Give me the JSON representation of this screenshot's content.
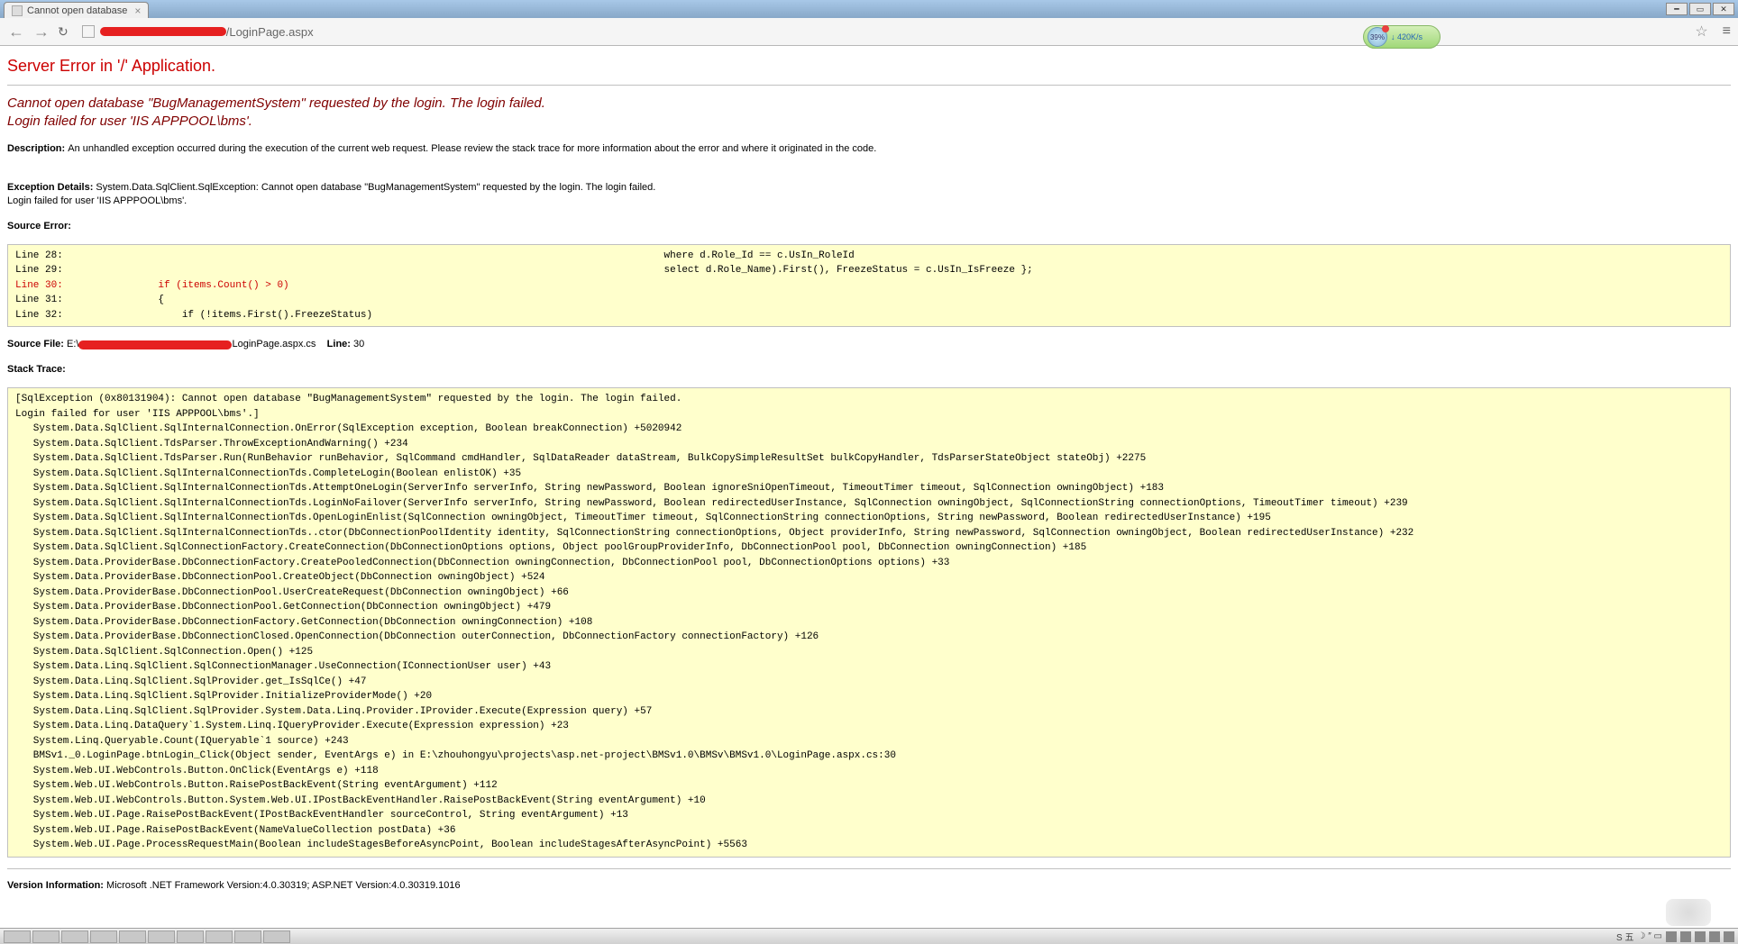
{
  "browser": {
    "tab_title": "Cannot open database",
    "url_suffix": "/LoginPage.aspx",
    "ext_badge_pct": "39%",
    "ext_speed": "420K/s"
  },
  "error": {
    "h1": "Server Error in '/' Application.",
    "h2_line1": "Cannot open database \"BugManagementSystem\" requested by the login. The login failed.",
    "h2_line2": "Login failed for user 'IIS APPPOOL\\bms'.",
    "desc_label": "Description:",
    "desc_text": "An unhandled exception occurred during the execution of the current web request. Please review the stack trace for more information about the error and where it originated in the code.",
    "exc_label": "Exception Details:",
    "exc_text": "System.Data.SqlClient.SqlException: Cannot open database \"BugManagementSystem\" requested by the login. The login failed.\nLogin failed for user 'IIS APPPOOL\\bms'.",
    "src_err_label": "Source Error:",
    "src_code_before": "Line 28:                                                                                                     where d.Role_Id == c.UsIn_RoleId\nLine 29:                                                                                                     select d.Role_Name).First(), FreezeStatus = c.UsIn_IsFreeze };",
    "src_code_red": "Line 30:                if (items.Count() > 0)",
    "src_code_after": "Line 31:                {\nLine 32:                    if (!items.First().FreezeStatus)",
    "src_file_label": "Source File:",
    "src_file_prefix": "E:\\",
    "src_file_suffix": "LoginPage.aspx.cs",
    "line_label": "Line:",
    "line_num": "30",
    "stack_label": "Stack Trace:",
    "stack_trace": "[SqlException (0x80131904): Cannot open database \"BugManagementSystem\" requested by the login. The login failed.\nLogin failed for user 'IIS APPPOOL\\bms'.]\n   System.Data.SqlClient.SqlInternalConnection.OnError(SqlException exception, Boolean breakConnection) +5020942\n   System.Data.SqlClient.TdsParser.ThrowExceptionAndWarning() +234\n   System.Data.SqlClient.TdsParser.Run(RunBehavior runBehavior, SqlCommand cmdHandler, SqlDataReader dataStream, BulkCopySimpleResultSet bulkCopyHandler, TdsParserStateObject stateObj) +2275\n   System.Data.SqlClient.SqlInternalConnectionTds.CompleteLogin(Boolean enlistOK) +35\n   System.Data.SqlClient.SqlInternalConnectionTds.AttemptOneLogin(ServerInfo serverInfo, String newPassword, Boolean ignoreSniOpenTimeout, TimeoutTimer timeout, SqlConnection owningObject) +183\n   System.Data.SqlClient.SqlInternalConnectionTds.LoginNoFailover(ServerInfo serverInfo, String newPassword, Boolean redirectedUserInstance, SqlConnection owningObject, SqlConnectionString connectionOptions, TimeoutTimer timeout) +239\n   System.Data.SqlClient.SqlInternalConnectionTds.OpenLoginEnlist(SqlConnection owningObject, TimeoutTimer timeout, SqlConnectionString connectionOptions, String newPassword, Boolean redirectedUserInstance) +195\n   System.Data.SqlClient.SqlInternalConnectionTds..ctor(DbConnectionPoolIdentity identity, SqlConnectionString connectionOptions, Object providerInfo, String newPassword, SqlConnection owningObject, Boolean redirectedUserInstance) +232\n   System.Data.SqlClient.SqlConnectionFactory.CreateConnection(DbConnectionOptions options, Object poolGroupProviderInfo, DbConnectionPool pool, DbConnection owningConnection) +185\n   System.Data.ProviderBase.DbConnectionFactory.CreatePooledConnection(DbConnection owningConnection, DbConnectionPool pool, DbConnectionOptions options) +33\n   System.Data.ProviderBase.DbConnectionPool.CreateObject(DbConnection owningObject) +524\n   System.Data.ProviderBase.DbConnectionPool.UserCreateRequest(DbConnection owningObject) +66\n   System.Data.ProviderBase.DbConnectionPool.GetConnection(DbConnection owningObject) +479\n   System.Data.ProviderBase.DbConnectionFactory.GetConnection(DbConnection owningConnection) +108\n   System.Data.ProviderBase.DbConnectionClosed.OpenConnection(DbConnection outerConnection, DbConnectionFactory connectionFactory) +126\n   System.Data.SqlClient.SqlConnection.Open() +125\n   System.Data.Linq.SqlClient.SqlConnectionManager.UseConnection(IConnectionUser user) +43\n   System.Data.Linq.SqlClient.SqlProvider.get_IsSqlCe() +47\n   System.Data.Linq.SqlClient.SqlProvider.InitializeProviderMode() +20\n   System.Data.Linq.SqlClient.SqlProvider.System.Data.Linq.Provider.IProvider.Execute(Expression query) +57\n   System.Data.Linq.DataQuery`1.System.Linq.IQueryProvider.Execute(Expression expression) +23\n   System.Linq.Queryable.Count(IQueryable`1 source) +243\n   BMSv1._0.LoginPage.btnLogin_Click(Object sender, EventArgs e) in E:\\zhouhongyu\\projects\\asp.net-project\\BMSv1.0\\BMSv\\BMSv1.0\\LoginPage.aspx.cs:30\n   System.Web.UI.WebControls.Button.OnClick(EventArgs e) +118\n   System.Web.UI.WebControls.Button.RaisePostBackEvent(String eventArgument) +112\n   System.Web.UI.WebControls.Button.System.Web.UI.IPostBackEventHandler.RaisePostBackEvent(String eventArgument) +10\n   System.Web.UI.Page.RaisePostBackEvent(IPostBackEventHandler sourceControl, String eventArgument) +13\n   System.Web.UI.Page.RaisePostBackEvent(NameValueCollection postData) +36\n   System.Web.UI.Page.ProcessRequestMain(Boolean includeStagesBeforeAsyncPoint, Boolean includeStagesAfterAsyncPoint) +5563",
    "version_label": "Version Information:",
    "version_text": "Microsoft .NET Framework Version:4.0.30319; ASP.NET Version:4.0.30319.1016"
  }
}
